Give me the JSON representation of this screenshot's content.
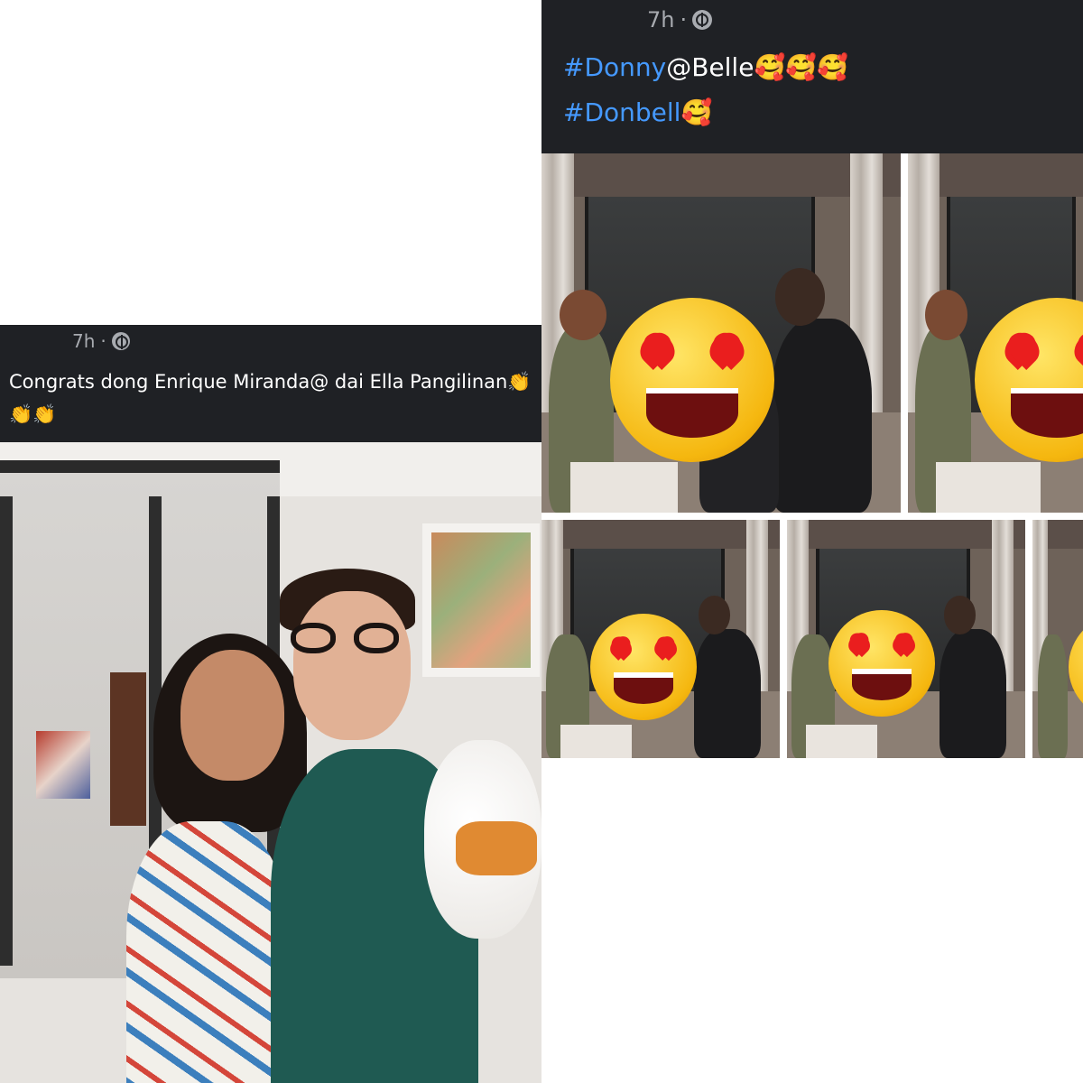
{
  "post_right": {
    "time": "7h",
    "separator": "·",
    "privacy_icon": "globe-icon",
    "line1": {
      "hashtag": "#Donny",
      "rest": "@Belle",
      "emoji": "🥰🥰🥰"
    },
    "line2": {
      "hashtag": "#Donbell",
      "emoji": "🥰"
    },
    "overlay_icon": "heart-eyes-emoji",
    "colors": {
      "header_bg": "#1f2125",
      "hashtag": "#4599ff",
      "meta": "#a8abb0"
    }
  },
  "post_left": {
    "time": "7h",
    "separator": "·",
    "privacy_icon": "globe-icon",
    "caption": "Congrats dong Enrique Miranda@ dai Ella Pangilinan👏👏👏",
    "colors": {
      "header_bg": "#1f2125",
      "text": "#ffffff"
    }
  }
}
